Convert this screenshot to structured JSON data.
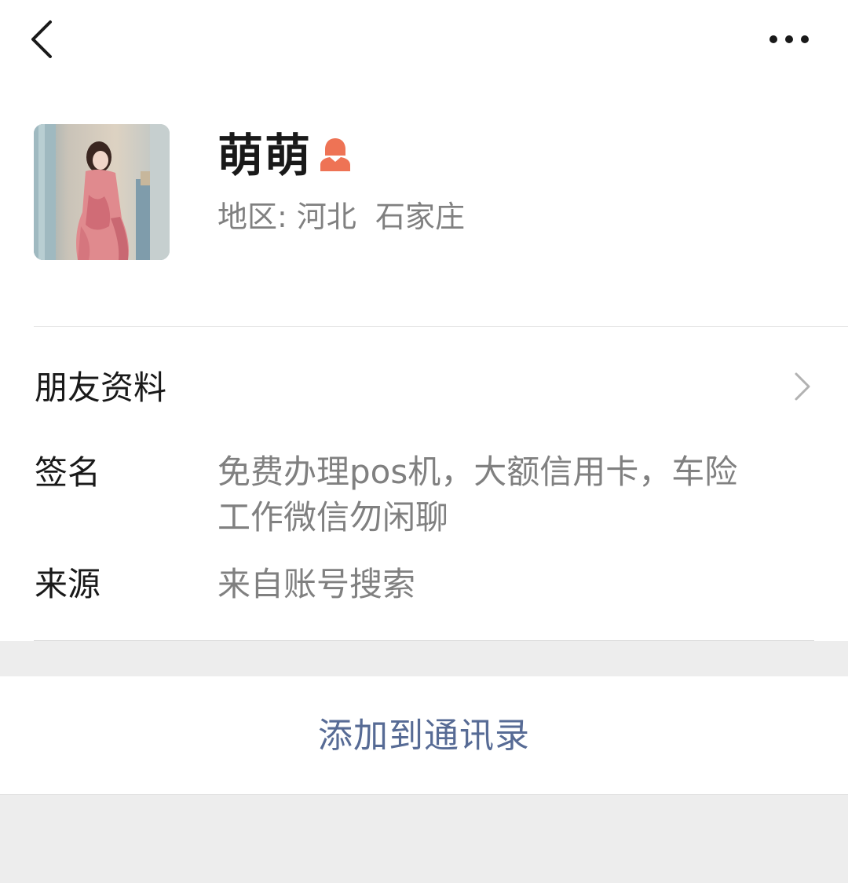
{
  "header": {
    "back_icon": "chevron-left-icon",
    "more_icon": "more-dots-icon"
  },
  "profile": {
    "nickname": "萌萌",
    "gender_icon": "female-user-icon",
    "gender_color": "#ee7355",
    "region_text": "地区: 河北  石家庄"
  },
  "rows": {
    "friend_info_label": "朋友资料",
    "signature_label": "签名",
    "signature_line1": "免费办理pos机，大额信用卡，车险",
    "signature_line2": "工作微信勿闲聊",
    "source_label": "来源",
    "source_value": "来自账号搜索"
  },
  "actions": {
    "add_to_contacts": "添加到通讯录",
    "accent_color": "#576b95"
  }
}
